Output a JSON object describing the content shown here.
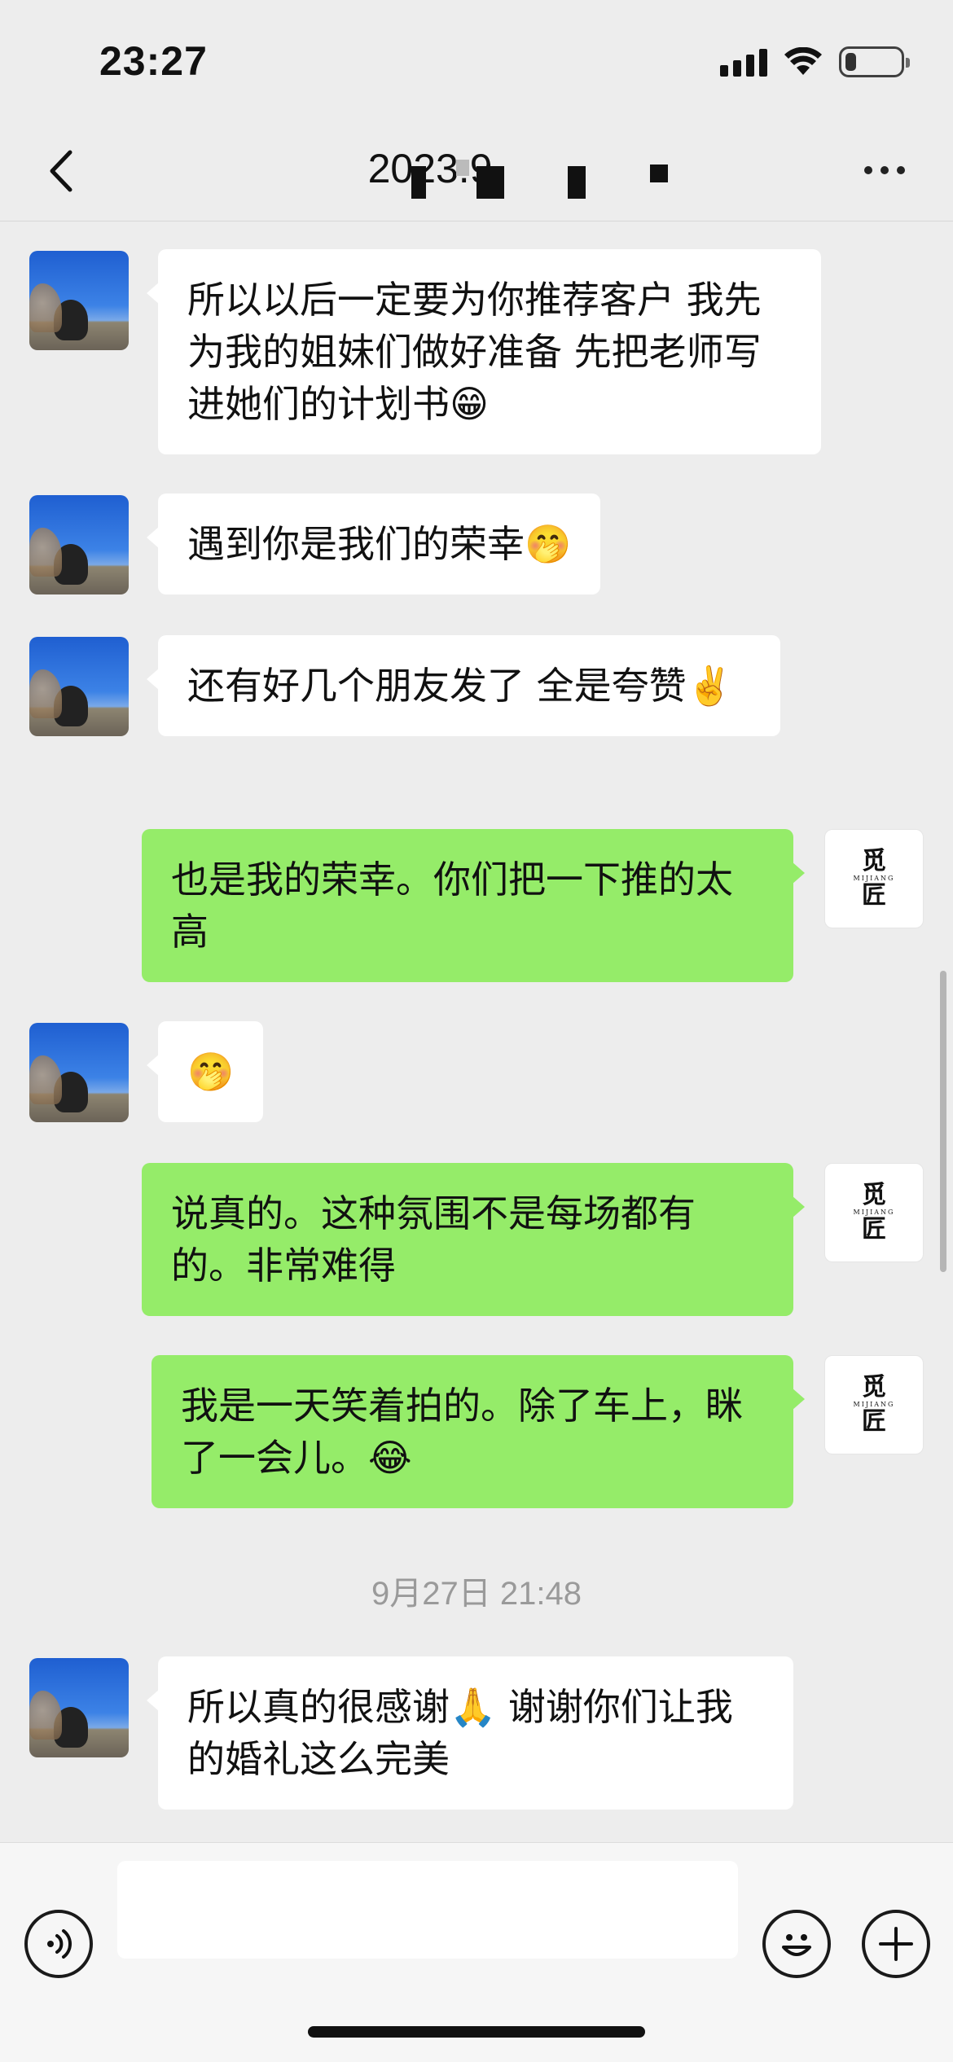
{
  "status_bar": {
    "time": "23:27",
    "signal_icon": "cellular-signal-icon",
    "wifi_icon": "wifi-icon",
    "battery_icon": "battery-low-icon",
    "battery_level": 0.2
  },
  "nav": {
    "back_icon": "chevron-left-icon",
    "title": "2023.9.",
    "more_icon": "more-dots-icon"
  },
  "messages": [
    {
      "side": "in",
      "text": "所以以后一定要为你推荐客户 我先为我的姐妹们做好准备 先把老师写进她们的计划书😁"
    },
    {
      "side": "in",
      "text": "遇到你是我们的荣幸🤭"
    },
    {
      "side": "in",
      "text": "还有好几个朋友发了 全是夸赞✌️"
    },
    {
      "side": "out",
      "text": "也是我的荣幸。你们把一下推的太高"
    },
    {
      "side": "in",
      "text": "🤭"
    },
    {
      "side": "out",
      "text": "说真的。这种氛围不是每场都有的。非常难得"
    },
    {
      "side": "out",
      "text": "我是一天笑着拍的。除了车上，眯了一会儿。😂"
    },
    {
      "side": "in",
      "text": "所以真的很感谢🙏 谢谢你们让我的婚礼这么完美"
    }
  ],
  "timestamp": "9月27日 21:48",
  "self_avatar": {
    "char_top": "觅",
    "sub": "MIJIANG",
    "char_bottom": "匠"
  },
  "input_bar": {
    "voice_icon": "voice-input-icon",
    "input_value": "",
    "emoji_icon": "emoji-icon",
    "plus_icon": "plus-icon"
  },
  "colors": {
    "background": "#ededed",
    "incoming_bubble": "#ffffff",
    "outgoing_bubble": "#95ec69",
    "timestamp_text": "#9a9a9a"
  }
}
